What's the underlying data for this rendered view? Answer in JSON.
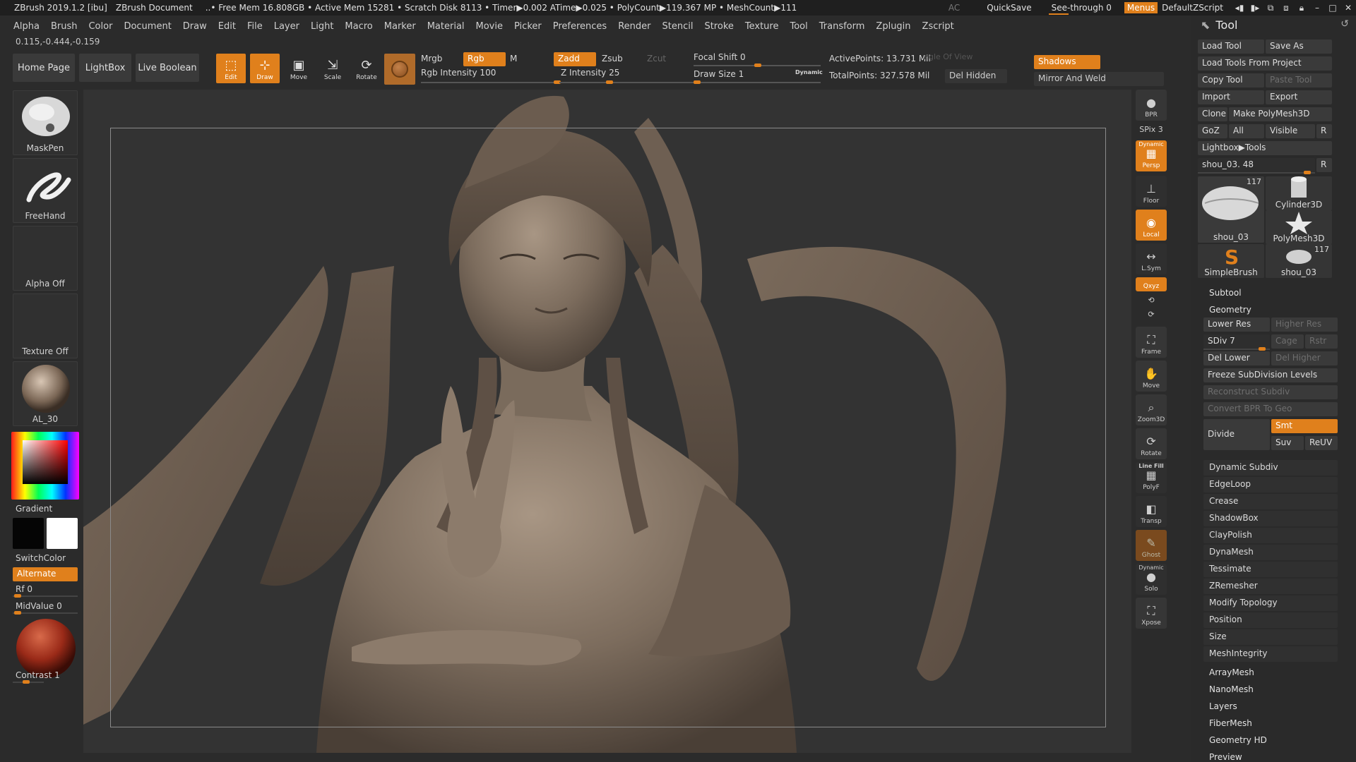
{
  "title_bar": {
    "app": "ZBrush 2019.1.2 [ibu]",
    "document": "ZBrush Document",
    "stats": "..• Free Mem 16.808GB • Active Mem 15281 • Scratch Disk 8113 • Timer▶0.002 ATime▶0.025 • PolyCount▶119.367 MP • MeshCount▶111",
    "ac": "AC",
    "quicksave": "QuickSave",
    "see_through": "See-through  0",
    "menus": "Menus",
    "default_script": "DefaultZScript"
  },
  "menu_bar": [
    "Alpha",
    "Brush",
    "Color",
    "Document",
    "Draw",
    "Edit",
    "File",
    "Layer",
    "Light",
    "Macro",
    "Marker",
    "Material",
    "Movie",
    "Picker",
    "Preferences",
    "Render",
    "Stencil",
    "Stroke",
    "Texture",
    "Tool",
    "Transform",
    "Zplugin",
    "Zscript"
  ],
  "coordinates": "0.115,-0.444,-0.159",
  "top_toolbar": {
    "home_page": "Home Page",
    "lightbox": "LightBox",
    "live_boolean": "Live Boolean",
    "edit": "Edit",
    "draw": "Draw",
    "move": "Move",
    "scale": "Scale",
    "rotate": "Rotate",
    "mrgb": "Mrgb",
    "rgb": "Rgb",
    "m": "M",
    "rgb_intensity": "Rgb Intensity 100",
    "zadd": "Zadd",
    "zsub": "Zsub",
    "zcut": "Zcut",
    "z_intensity": "Z Intensity 25",
    "focal_shift": "Focal Shift 0",
    "draw_size": "Draw Size 1",
    "dynamic": "Dynamic",
    "active_points": "ActivePoints: 13.731 Mil",
    "total_points": "TotalPoints: 327.578 Mil",
    "angle_of_view": "ngle Of View",
    "del_hidden": "Del Hidden",
    "shadows": "Shadows",
    "mirror_and_weld": "Mirror And Weld"
  },
  "left_panel": {
    "brush": "MaskPen",
    "stroke": "FreeHand",
    "alpha": "Alpha Off",
    "texture": "Texture Off",
    "material": "AL_30",
    "gradient": "Gradient",
    "switch_color": "SwitchColor",
    "alternate": "Alternate",
    "rf": "Rf 0",
    "mid_value": "MidValue 0",
    "contrast": "Contrast 1"
  },
  "right_shelf": {
    "bpr": "BPR",
    "spix": "SPix 3",
    "dynamic_persp": "Persp",
    "dynamic_label": "Dynamic",
    "floor": "Floor",
    "local": "Local",
    "lsym": "L.Sym",
    "xyz": "Qxyz",
    "frame": "Frame",
    "move": "Move",
    "zoom3d": "Zoom3D",
    "rotate": "Rotate",
    "line_fill": "Line Fill",
    "polyf": "PolyF",
    "transp": "Transp",
    "ghost": "Ghost",
    "solo_dynamic": "Dynamic",
    "solo": "Solo",
    "xpose": "Xpose"
  },
  "tool_palette": {
    "title": "Tool",
    "load_tool": "Load Tool",
    "save_as": "Save As",
    "load_tools_from_project": "Load Tools From Project",
    "copy_tool": "Copy Tool",
    "paste_tool": "Paste Tool",
    "import": "Import",
    "export": "Export",
    "clone": "Clone",
    "make_polymesh3d": "Make PolyMesh3D",
    "goz": "GoZ",
    "all": "All",
    "visible": "Visible",
    "r": "R",
    "lightbox_tools": "Lightbox▶Tools",
    "shou_slider": "shou_03. 48",
    "thumbs": [
      {
        "name": "shou_03",
        "count": "117"
      },
      {
        "name": "Cylinder3D",
        "count": ""
      },
      {
        "name": "PolyMesh3D",
        "count": ""
      },
      {
        "name": "SimpleBrush",
        "count": ""
      },
      {
        "name": "shou_03",
        "count": "117"
      }
    ],
    "subtool": "Subtool",
    "geometry": "Geometry",
    "lower_res": "Lower Res",
    "higher_res": "Higher Res",
    "sdiv": "SDiv 7",
    "cage": "Cage",
    "rstr": "Rstr",
    "del_lower": "Del Lower",
    "del_higher": "Del Higher",
    "freeze_subdiv": "Freeze SubDivision Levels",
    "reconstruct_subdiv": "Reconstruct Subdiv",
    "convert_bpr": "Convert BPR To Geo",
    "divide": "Divide",
    "smt": "Smt",
    "suv": "Suv",
    "reuv": "ReUV",
    "geometry_items": [
      "Dynamic Subdiv",
      "EdgeLoop",
      "Crease",
      "ShadowBox",
      "ClayPolish",
      "DynaMesh",
      "Tessimate",
      "ZRemesher",
      "Modify Topology",
      "Position",
      "Size",
      "MeshIntegrity"
    ],
    "sections": [
      "ArrayMesh",
      "NanoMesh",
      "Layers",
      "FiberMesh",
      "Geometry HD",
      "Preview"
    ]
  },
  "colors": {
    "accent": "#e0801c",
    "background": "#2b2b2b",
    "canvas": "#333333",
    "sculpt_clay": "#8a7b6c"
  }
}
